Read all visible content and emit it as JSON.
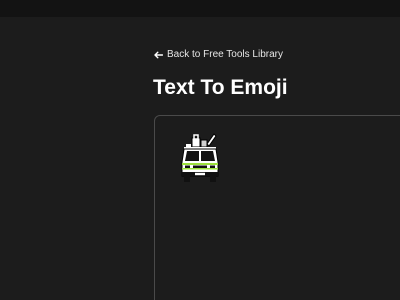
{
  "navigation": {
    "back_label": "Back to Free Tools Library"
  },
  "page": {
    "title": "Text To Emoji"
  },
  "output": {
    "emoji_icon": "van-with-luggage-icon"
  },
  "colors": {
    "background": "#1c1c1c",
    "panel_border": "#4a4a4a",
    "text": "#ffffff",
    "accent": "#9be13b"
  }
}
